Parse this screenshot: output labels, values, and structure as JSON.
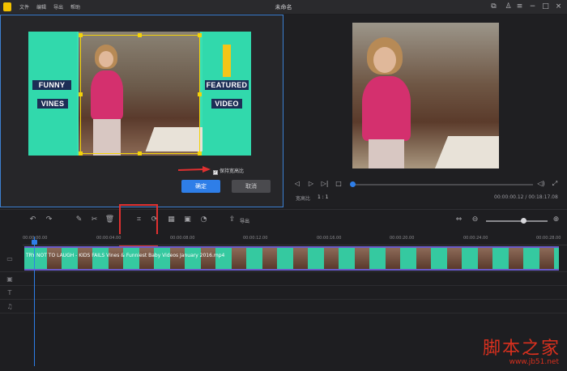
{
  "app": {
    "title": "未命名",
    "menu": [
      "文件",
      "编辑",
      "导出",
      "帮助"
    ]
  },
  "crop_dialog": {
    "left_label_1": "FUNNY",
    "left_label_2": "VINES",
    "right_label_1": "FEATURED",
    "right_label_2": "VIDEO",
    "keep_ratio_label": "保持宽高比",
    "keep_ratio_checked": true,
    "ok_label": "确定",
    "cancel_label": "取消"
  },
  "preview": {
    "ratio_label": "宽高比",
    "ratio_value": "1 : 1",
    "time": "00:00:00.12 / 00:18:17.08",
    "progress": 0.0
  },
  "toolbar": {
    "crop_tooltip": "裁剪",
    "export_label": "导出",
    "zoom_level": 0.6
  },
  "timeline": {
    "ticks": [
      "00:00:00.00",
      "00:00:04.00",
      "00:00:08.00",
      "00:00:12.00",
      "00:00:16.00",
      "00:00:20.00",
      "00:00:24.00",
      "00:00:28.00"
    ],
    "clip_title": "TRY NOT TO LAUGH - KIDS FAILS Vines & Funniest Baby Videos January 2016.mp4"
  },
  "watermark": {
    "text": "脚本之家",
    "url": "www.jb51.net"
  },
  "colors": {
    "accent": "#2e7ee8",
    "crop_frame": "#f3d20a",
    "highlight": "#e03030",
    "teal": "#38dfb4"
  }
}
